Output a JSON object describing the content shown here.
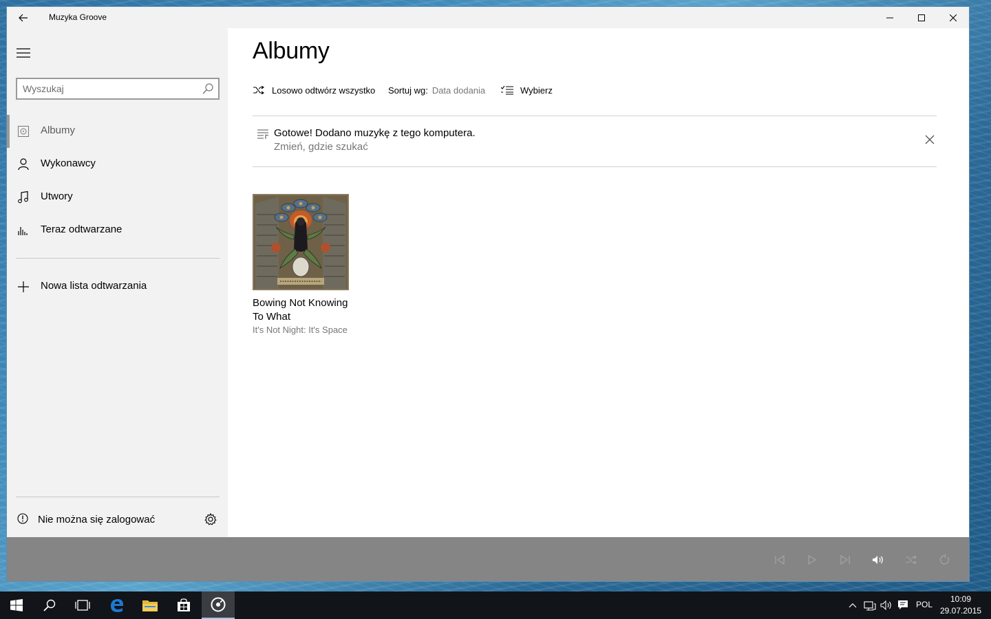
{
  "window": {
    "title": "Muzyka Groove"
  },
  "sidebar": {
    "search_placeholder": "Wyszukaj",
    "items": [
      {
        "label": "Albumy",
        "icon": "album-icon",
        "active": true
      },
      {
        "label": "Wykonawcy",
        "icon": "person-icon"
      },
      {
        "label": "Utwory",
        "icon": "music-note-icon"
      },
      {
        "label": "Teraz odtwarzane",
        "icon": "equalizer-icon"
      }
    ],
    "new_playlist_label": "Nowa lista odtwarzania",
    "signin_label": "Nie można się zalogować"
  },
  "main": {
    "page_title": "Albumy",
    "toolbar": {
      "shuffle_label": "Losowo odtwórz wszystko",
      "sort_label": "Sortuj wg:",
      "sort_value": "Data dodania",
      "select_label": "Wybierz"
    },
    "notice": {
      "message": "Gotowe! Dodano muzykę z tego komputera.",
      "link": "Zmień, gdzie szukać"
    },
    "albums": [
      {
        "title": "Bowing Not Knowing To What",
        "artist": "It's Not Night: It's Space"
      }
    ]
  },
  "taskbar": {
    "language": "POL",
    "time": "10:09",
    "date": "29.07.2015"
  },
  "colors": {
    "sidebar_bg": "#f2f2f2",
    "player_bg": "#858585",
    "taskbar_bg": "#111418",
    "edge_blue": "#1e78d2"
  }
}
